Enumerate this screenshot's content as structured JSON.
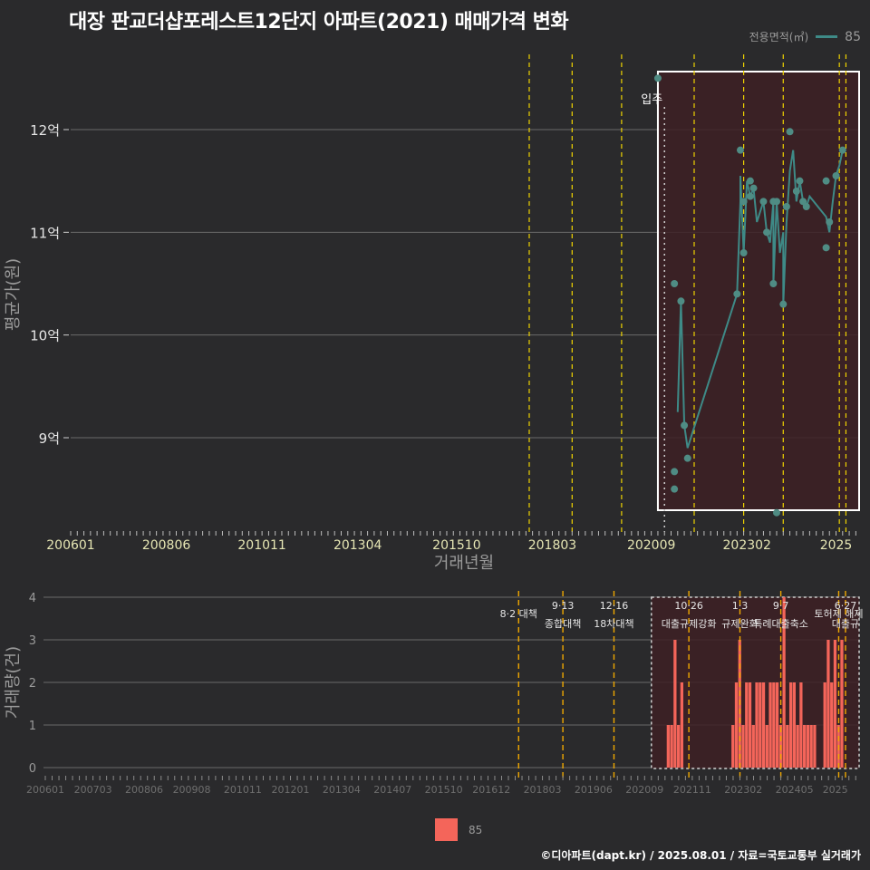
{
  "title": "대장 판교더샵포레스트12단지 아파트(2021) 매매가격 변화",
  "footer": "©디아파트(dapt.kr) / 2025.08.01 / 자료=국토교통부 실거래가",
  "legend": {
    "top_title": "전용면적(㎡)",
    "top_value": "85",
    "bottom_value": "85"
  },
  "colors": {
    "background": "#2a2a2c",
    "line": "#3e8a87",
    "point": "#4f8c84",
    "bar": "#f4655a",
    "policy_line": "#f0d400",
    "policy_line_bottom": "#f0a800",
    "highlight_fill": "#3d2024"
  },
  "chart_data": [
    {
      "type": "line",
      "title": "대장 판교더샵포레스트12단지 아파트(2021) 매매가격 변화",
      "xlabel": "거래년월",
      "ylabel": "평균가(원)",
      "x_ticks": [
        "200601",
        "200806",
        "201011",
        "201304",
        "201510",
        "201803",
        "202009",
        "202302",
        "2025"
      ],
      "y_ticks": [
        {
          "value": 9,
          "label": "9억"
        },
        {
          "value": 10,
          "label": "10억"
        },
        {
          "value": 11,
          "label": "11억"
        },
        {
          "value": 12,
          "label": "12억"
        }
      ],
      "ylim": [
        8.1,
        12.75
      ],
      "grid": true,
      "annotation": "입주",
      "move_in": "2021.01",
      "policy_dates": [
        "2017.08",
        "2018.09",
        "2019.12",
        "2021.10",
        "2023.01",
        "2024.01",
        "2025.06",
        "2025.08"
      ],
      "highlight_range": [
        "2020.11",
        "2025.12"
      ],
      "series": [
        {
          "name": "85",
          "line": [
            [
              "2021.05",
              9.25
            ],
            [
              "2021.06",
              10.33
            ],
            [
              "2021.07",
              9.12
            ],
            [
              "2021.08",
              8.9
            ],
            [
              "2022.11",
              10.4
            ],
            [
              "2022.12",
              11.3
            ],
            [
              "2022.12",
              11.55
            ],
            [
              "2023.01",
              10.8
            ],
            [
              "2023.02",
              11.5
            ],
            [
              "2023.03",
              11.35
            ],
            [
              "2023.04",
              11.43
            ],
            [
              "2023.05",
              11.1
            ],
            [
              "2023.07",
              11.3
            ],
            [
              "2023.08",
              11.0
            ],
            [
              "2023.09",
              10.9
            ],
            [
              "2023.10",
              11.3
            ],
            [
              "2023.10",
              10.5
            ],
            [
              "2023.11",
              11.3
            ],
            [
              "2023.12",
              10.8
            ],
            [
              "2024.01",
              11.0
            ],
            [
              "2024.01",
              10.3
            ],
            [
              "2024.02",
              11.1
            ],
            [
              "2024.03",
              11.6
            ],
            [
              "2024.04",
              11.8
            ],
            [
              "2024.05",
              11.3
            ],
            [
              "2024.06",
              11.5
            ],
            [
              "2024.07",
              11.3
            ],
            [
              "2024.08",
              11.25
            ],
            [
              "2024.09",
              11.35
            ],
            [
              "2025.02",
              11.15
            ],
            [
              "2025.03",
              11.0
            ],
            [
              "2025.04",
              11.3
            ],
            [
              "2025.05",
              11.55
            ],
            [
              "2025.06",
              11.65
            ],
            [
              "2025.07",
              11.8
            ]
          ],
          "points": [
            [
              "2020.11",
              12.5
            ],
            [
              "2021.04",
              10.5
            ],
            [
              "2021.04",
              8.67
            ],
            [
              "2021.04",
              8.5
            ],
            [
              "2021.06",
              10.33
            ],
            [
              "2021.07",
              9.12
            ],
            [
              "2021.08",
              8.8
            ],
            [
              "2022.11",
              10.4
            ],
            [
              "2022.12",
              11.8
            ],
            [
              "2023.01",
              11.3
            ],
            [
              "2023.01",
              10.8
            ],
            [
              "2023.03",
              11.35
            ],
            [
              "2023.03",
              11.5
            ],
            [
              "2023.04",
              11.43
            ],
            [
              "2023.07",
              11.3
            ],
            [
              "2023.08",
              11.0
            ],
            [
              "2023.10",
              10.5
            ],
            [
              "2023.10",
              11.3
            ],
            [
              "2023.11",
              8.27
            ],
            [
              "2023.11",
              11.3
            ],
            [
              "2024.01",
              10.3
            ],
            [
              "2024.02",
              11.25
            ],
            [
              "2024.03",
              11.98
            ],
            [
              "2024.05",
              11.4
            ],
            [
              "2024.06",
              11.5
            ],
            [
              "2024.07",
              11.3
            ],
            [
              "2024.08",
              11.25
            ],
            [
              "2025.02",
              11.5
            ],
            [
              "2025.02",
              10.85
            ],
            [
              "2025.03",
              11.1
            ],
            [
              "2025.05",
              11.55
            ],
            [
              "2025.07",
              11.8
            ]
          ]
        }
      ]
    },
    {
      "type": "bar",
      "xlabel": "",
      "ylabel": "거래량(건)",
      "x_ticks": [
        "200601",
        "200703",
        "200806",
        "200908",
        "201011",
        "201201",
        "201304",
        "201407",
        "201510",
        "201612",
        "201803",
        "201906",
        "202009",
        "202111",
        "202302",
        "202405",
        "2025"
      ],
      "ylim": [
        0,
        4
      ],
      "y_ticks": [
        0,
        1,
        2,
        3,
        4
      ],
      "grid": true,
      "highlight_range": [
        "2020.11",
        "2025.12"
      ],
      "policy_annotations": [
        {
          "date": "2017.08",
          "label": "8·2 대책"
        },
        {
          "date": "2018.09",
          "label": "9·13",
          "label2": "종합대책"
        },
        {
          "date": "2019.12",
          "label": "12·16",
          "label2": "18차대책"
        },
        {
          "date": "2021.10",
          "label": "10·26",
          "label2": "대출규제강화"
        },
        {
          "date": "2023.01",
          "label": "1·3",
          "label2": "규제완화"
        },
        {
          "date": "2024.01",
          "label": "9·7",
          "label2": "특례대출축소"
        },
        {
          "date": "2025.06",
          "label": "토허제 해제"
        },
        {
          "date": "2025.08",
          "label": "6·27",
          "label2": "대출규"
        }
      ],
      "series": [
        {
          "name": "85",
          "bars": [
            [
              "2021.04",
              1
            ],
            [
              "2021.05",
              1
            ],
            [
              "2021.06",
              3
            ],
            [
              "2021.07",
              1
            ],
            [
              "2021.08",
              2
            ],
            [
              "2022.11",
              1
            ],
            [
              "2022.12",
              2
            ],
            [
              "2023.01",
              3
            ],
            [
              "2023.02",
              1
            ],
            [
              "2023.03",
              2
            ],
            [
              "2023.04",
              2
            ],
            [
              "2023.05",
              1
            ],
            [
              "2023.06",
              2
            ],
            [
              "2023.07",
              2
            ],
            [
              "2023.08",
              2
            ],
            [
              "2023.09",
              1
            ],
            [
              "2023.10",
              2
            ],
            [
              "2023.11",
              2
            ],
            [
              "2023.12",
              2
            ],
            [
              "2024.01",
              1
            ],
            [
              "2024.02",
              4
            ],
            [
              "2024.03",
              1
            ],
            [
              "2024.04",
              2
            ],
            [
              "2024.05",
              2
            ],
            [
              "2024.06",
              1
            ],
            [
              "2024.07",
              2
            ],
            [
              "2024.08",
              1
            ],
            [
              "2024.09",
              1
            ],
            [
              "2024.10",
              1
            ],
            [
              "2024.11",
              1
            ],
            [
              "2025.02",
              2
            ],
            [
              "2025.03",
              3
            ],
            [
              "2025.04",
              2
            ],
            [
              "2025.05",
              3
            ],
            [
              "2025.06",
              1
            ],
            [
              "2025.07",
              3
            ]
          ]
        }
      ]
    }
  ]
}
